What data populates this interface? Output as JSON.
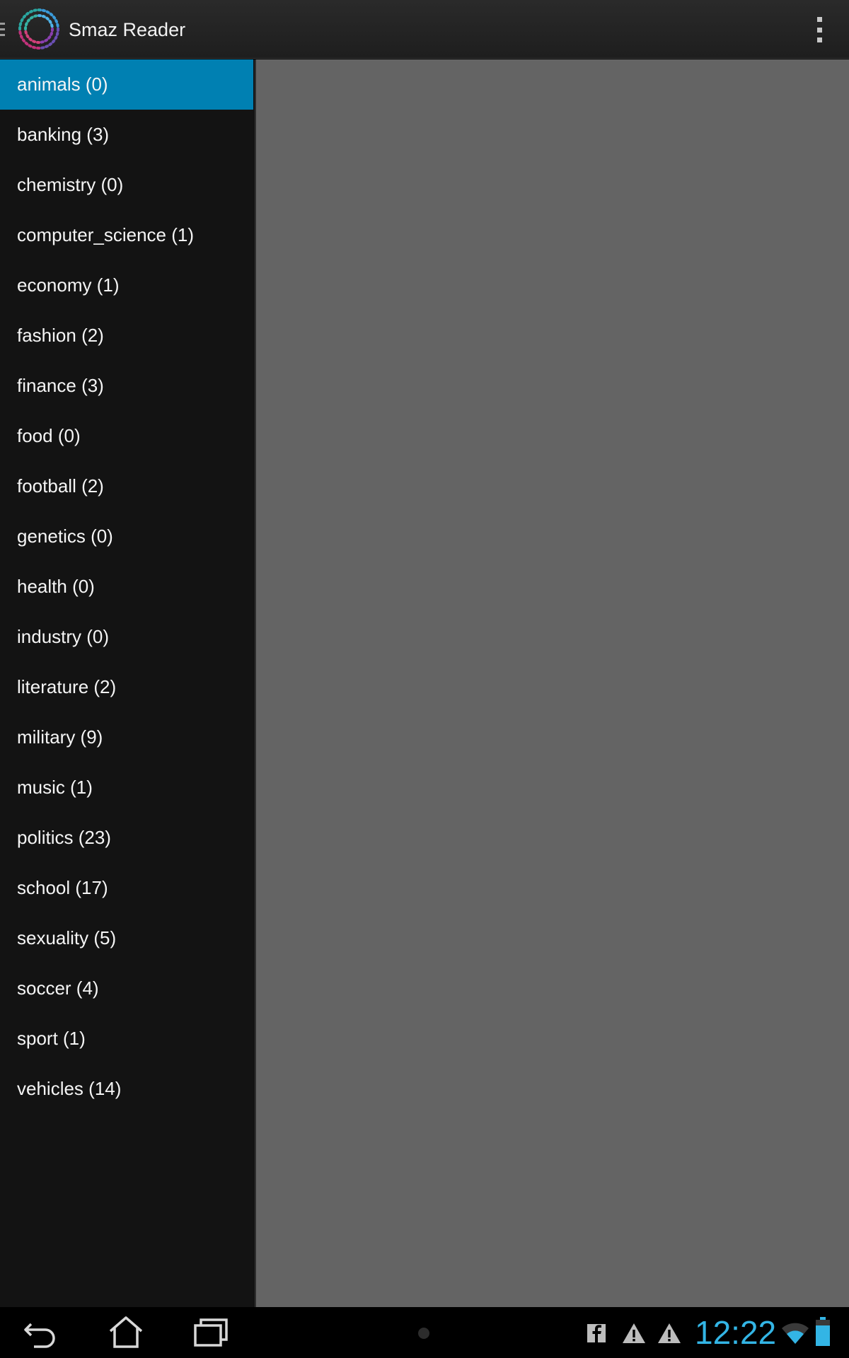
{
  "app": {
    "title": "Smaz Reader"
  },
  "drawer": {
    "selected_index": 0,
    "items": [
      {
        "label": "animals (0)"
      },
      {
        "label": "banking (3)"
      },
      {
        "label": "chemistry (0)"
      },
      {
        "label": "computer_science (1)"
      },
      {
        "label": "economy (1)"
      },
      {
        "label": "fashion (2)"
      },
      {
        "label": "finance (3)"
      },
      {
        "label": "food (0)"
      },
      {
        "label": "football (2)"
      },
      {
        "label": "genetics (0)"
      },
      {
        "label": "health (0)"
      },
      {
        "label": "industry (0)"
      },
      {
        "label": "literature (2)"
      },
      {
        "label": "military (9)"
      },
      {
        "label": "music (1)"
      },
      {
        "label": "politics (23)"
      },
      {
        "label": "school (17)"
      },
      {
        "label": "sexuality (5)"
      },
      {
        "label": "soccer (4)"
      },
      {
        "label": "sport (1)"
      },
      {
        "label": "vehicles (14)"
      }
    ]
  },
  "system_bar": {
    "clock": "12:22",
    "icons": [
      "back-icon",
      "home-icon",
      "recents-icon",
      "facebook-notification-icon",
      "warning-icon",
      "warning-icon",
      "wifi-icon",
      "battery-icon"
    ]
  },
  "colors": {
    "accent": "#33b5e5",
    "selected_item": "#0080b2",
    "drawer_bg": "#131313",
    "content_bg": "#646464",
    "action_bar_bg": "#242424"
  }
}
